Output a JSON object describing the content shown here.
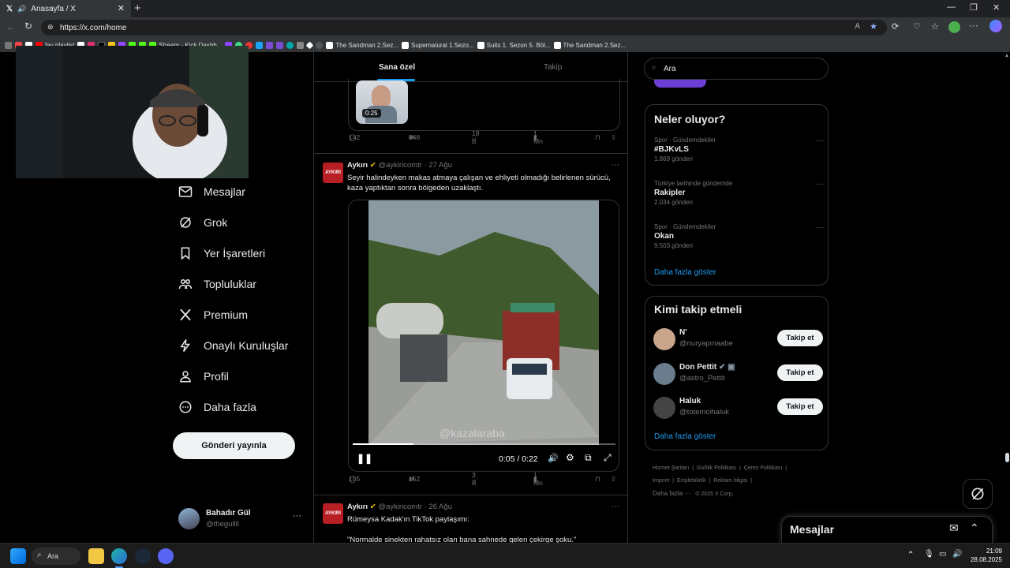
{
  "browser": {
    "tab_title": "Anasayfa / X",
    "url": "https://x.com/home",
    "bookmarks": [
      {
        "label": "fav playlist",
        "color": "#ff0000"
      },
      {
        "label": "Stream - Kick Dashb...",
        "color": "#53fc18"
      },
      {
        "label": "The Sandman 2.Sez...",
        "color": "#ffffff"
      },
      {
        "label": "Supernatural 1.Sezo...",
        "color": "#ffffff"
      },
      {
        "label": "Suits 1. Sezon 5. Böl...",
        "color": "#ffffff"
      },
      {
        "label": "The Sandman 2.Sez...",
        "color": "#ffffff"
      }
    ]
  },
  "sidebar": {
    "items": [
      {
        "label": "Mesajlar",
        "icon": "envelope-icon"
      },
      {
        "label": "Grok",
        "icon": "grok-icon"
      },
      {
        "label": "Yer İşaretleri",
        "icon": "bookmark-icon"
      },
      {
        "label": "Topluluklar",
        "icon": "communities-icon"
      },
      {
        "label": "Premium",
        "icon": "x-logo-icon"
      },
      {
        "label": "Onaylı Kuruluşlar",
        "icon": "lightning-icon"
      },
      {
        "label": "Profil",
        "icon": "person-icon"
      },
      {
        "label": "Daha fazla",
        "icon": "more-circle-icon"
      }
    ],
    "post_button": "Gönderi yayınla",
    "user": {
      "name": "Bahadır Gül",
      "handle": "@thegullll"
    }
  },
  "timeline": {
    "tabs": [
      "Sana özel",
      "Takip"
    ],
    "prev_tweet": {
      "video_duration": "0:25",
      "actions": {
        "replies": "142",
        "reposts": "548",
        "likes": "18 B",
        "views": "1 Mn"
      }
    },
    "tweet1": {
      "avatar_text": "AYKIRI",
      "name": "Aykırı",
      "handle": "@aykiricomtr",
      "date": "· 27 Ağu",
      "text": "Seyir halindeyken makas atmaya çalışan ve ehliyeti olmadığı belirlenen sürücü, kaza yaptıktan sonra bölgeden uzaklaştı.",
      "video": {
        "time": "0:05 / 0:22",
        "progress": 0.23,
        "watermark": "@kazalaraba"
      },
      "actions": {
        "replies": "155",
        "reposts": "152",
        "likes": "3 B",
        "views": "1 Mn"
      }
    },
    "tweet2": {
      "avatar_text": "AYKIRI",
      "name": "Aykırı",
      "handle": "@aykiricomtr",
      "date": "· 26 Ağu",
      "text": "Rümeysa Kadak'ın TikTok paylaşımı:",
      "quote": "\"Normalde sinekten rahatsız olan bana sahnede gelen çekirge şoku.\""
    }
  },
  "right": {
    "search_placeholder": "Ara",
    "trends_title": "Neler oluyor?",
    "trends": [
      {
        "context": "Spor · Gündemdekiler",
        "name": "#BJKvLS",
        "count": "1.869 gönderi"
      },
      {
        "context": "Türkiye tarihinde gündemde",
        "name": "Rakipler",
        "count": "2.034 gönderi"
      },
      {
        "context": "Spor · Gündemdekiler",
        "name": "Okan",
        "count": "9.503 gönderi"
      }
    ],
    "trends_more": "Daha fazla göster",
    "who_title": "Kimi takip etmeli",
    "who": [
      {
        "name": "N'",
        "handle": "@nuryapmaabe",
        "button": "Takip et",
        "color": "#c9a58c"
      },
      {
        "name": "Don Pettit",
        "handle": "@astro_Pettit",
        "button": "Takip et",
        "color": "#6a7b8c"
      },
      {
        "name": "Haluk",
        "handle": "@totemcihaluk",
        "button": "Takip et",
        "color": "#444"
      }
    ],
    "who_more": "Daha fazla göster",
    "footer": {
      "line1": [
        "Hizmet Şartları",
        "Gizlilik Politikası",
        "Çerez Politikası"
      ],
      "line2": [
        "Imprint",
        "Erişilebilirlik",
        "Reklam bilgisi"
      ],
      "more": "Daha fazla ···",
      "copyright": "© 2025 X Corp."
    },
    "messages_dock": "Mesajlar"
  },
  "taskbar": {
    "search": "Ara",
    "time": "21:09",
    "date": "28.08.2025"
  }
}
